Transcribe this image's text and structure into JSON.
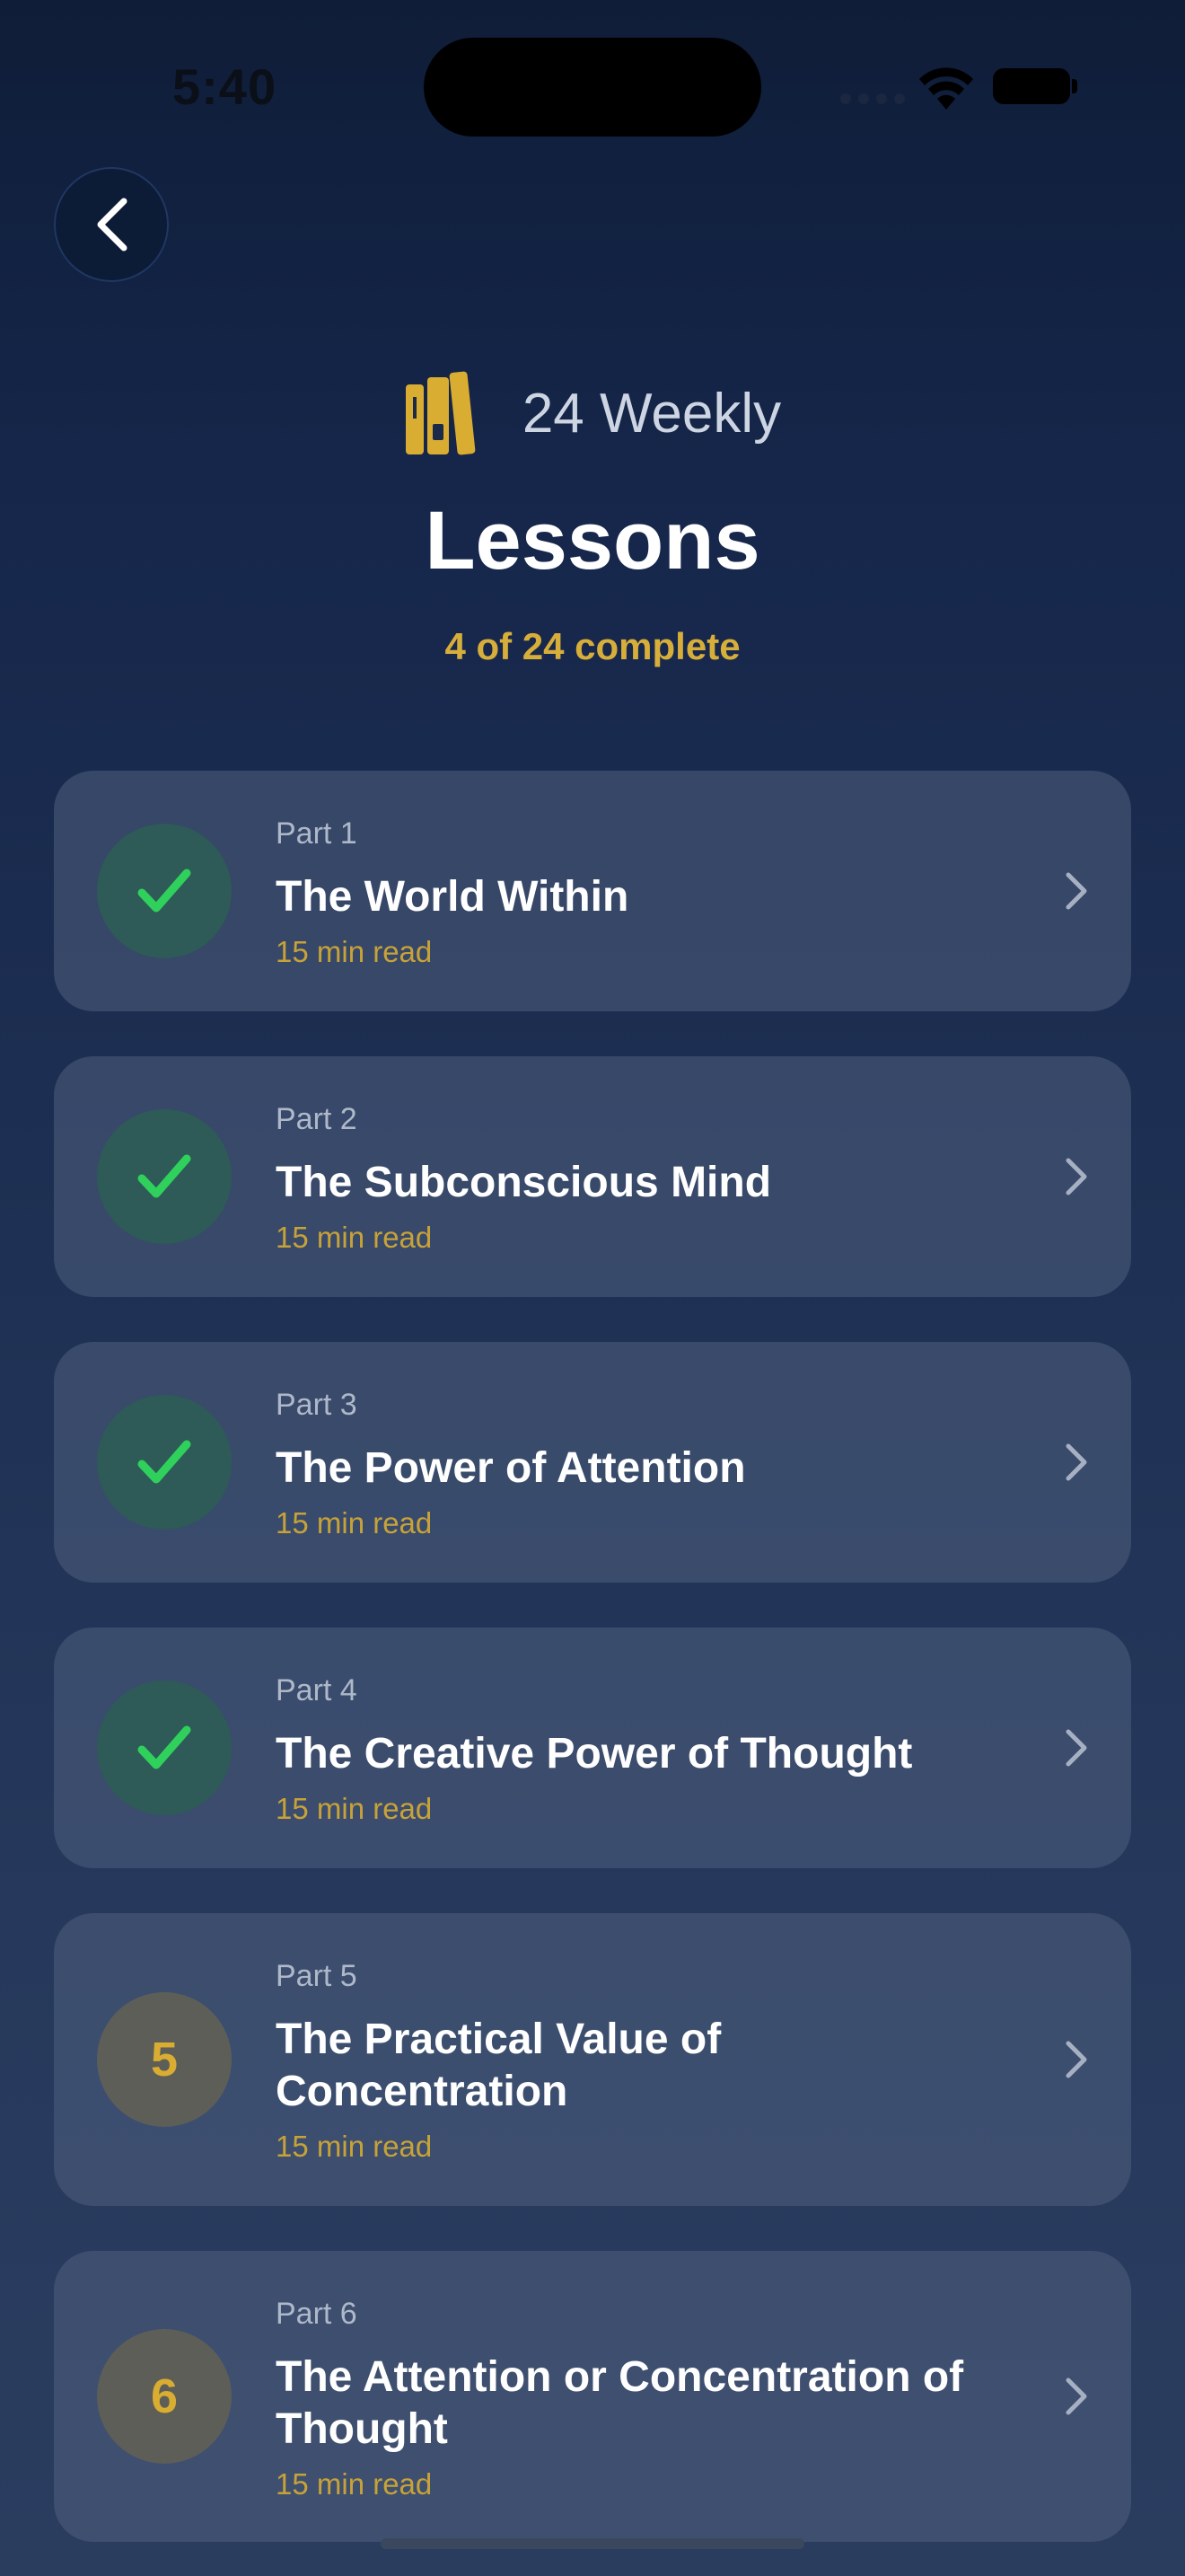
{
  "status_bar": {
    "time": "5:40"
  },
  "header": {
    "subtitle": "24 Weekly",
    "title": "Lessons",
    "progress": "4 of 24 complete",
    "icon": "books-icon",
    "accent_color": "#d9ac32"
  },
  "lessons": [
    {
      "part": "Part 1",
      "title": "The World Within",
      "meta": "15 min read",
      "completed": true,
      "number": "1"
    },
    {
      "part": "Part 2",
      "title": "The Subconscious Mind",
      "meta": "15 min read",
      "completed": true,
      "number": "2"
    },
    {
      "part": "Part 3",
      "title": "The Power of Attention",
      "meta": "15 min read",
      "completed": true,
      "number": "3"
    },
    {
      "part": "Part 4",
      "title": "The Creative Power of Thought",
      "meta": "15 min read",
      "completed": true,
      "number": "4"
    },
    {
      "part": "Part 5",
      "title": "The Practical Value of Concentration",
      "meta": "15 min read",
      "completed": false,
      "number": "5"
    },
    {
      "part": "Part 6",
      "title": "The Attention or Concentration of Thought",
      "meta": "15 min read",
      "completed": false,
      "number": "6"
    }
  ],
  "colors": {
    "check_green": "#2fd15c",
    "completed_circle": "#2e5a57",
    "pending_circle": "#5d5e58"
  }
}
